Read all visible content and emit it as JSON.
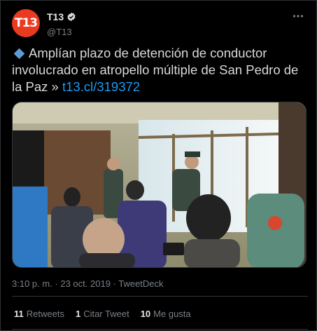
{
  "account": {
    "display_name": "T13",
    "handle": "@T13",
    "avatar_text": "T13",
    "brand_color": "#ea3a1f",
    "verified_color": "#d9d9d9"
  },
  "tweet": {
    "text": "Amplían plazo de detención de conductor involucrado en atropello múltiple de San Pedro de la Paz »",
    "link_text": "t13.cl/319372",
    "timestamp": "3:10 p. m. · 23 oct. 2019 · TweetDeck"
  },
  "stats": {
    "retweets_count": "11",
    "retweets_label": "Retweets",
    "quotes_count": "1",
    "quotes_label": "Citar Tweet",
    "likes_count": "10",
    "likes_label": "Me gusta"
  },
  "icons": {
    "verified": "verified-badge-icon",
    "more": "more-options-icon",
    "bullet": "blue-diamond-icon"
  },
  "colors": {
    "link": "#1d9bf0",
    "muted": "#7a8086",
    "background": "#000000"
  }
}
